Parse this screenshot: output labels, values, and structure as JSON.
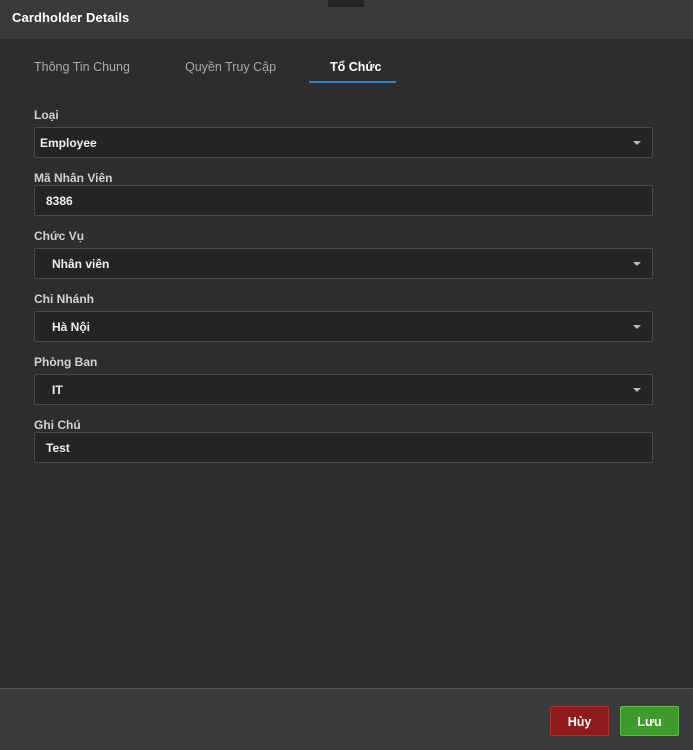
{
  "window": {
    "title": "Cardholder Details"
  },
  "tabs": [
    {
      "label": "Thông Tin Chung",
      "active": false
    },
    {
      "label": "Quyền Truy Cập",
      "active": false
    },
    {
      "label": "Tổ Chức",
      "active": true
    }
  ],
  "form": {
    "type": {
      "label": "Loại",
      "value": "Employee"
    },
    "employee_id": {
      "label": "Mã Nhân Viên",
      "value": "8386"
    },
    "position": {
      "label": "Chức Vụ",
      "value": "Nhân viên"
    },
    "branch": {
      "label": "Chi Nhánh",
      "value": "Hà Nội"
    },
    "department": {
      "label": "Phòng Ban",
      "value": "IT"
    },
    "note": {
      "label": "Ghi Chú",
      "value": "Test"
    }
  },
  "footer": {
    "cancel_label": "Hủy",
    "save_label": "Lưu"
  },
  "colors": {
    "accent": "#2f83d3",
    "cancel": "#8e1b1b",
    "save": "#3e9a2c",
    "background": "#2d2d2f"
  },
  "icons": {
    "dropdown": "chevron-down-icon"
  }
}
